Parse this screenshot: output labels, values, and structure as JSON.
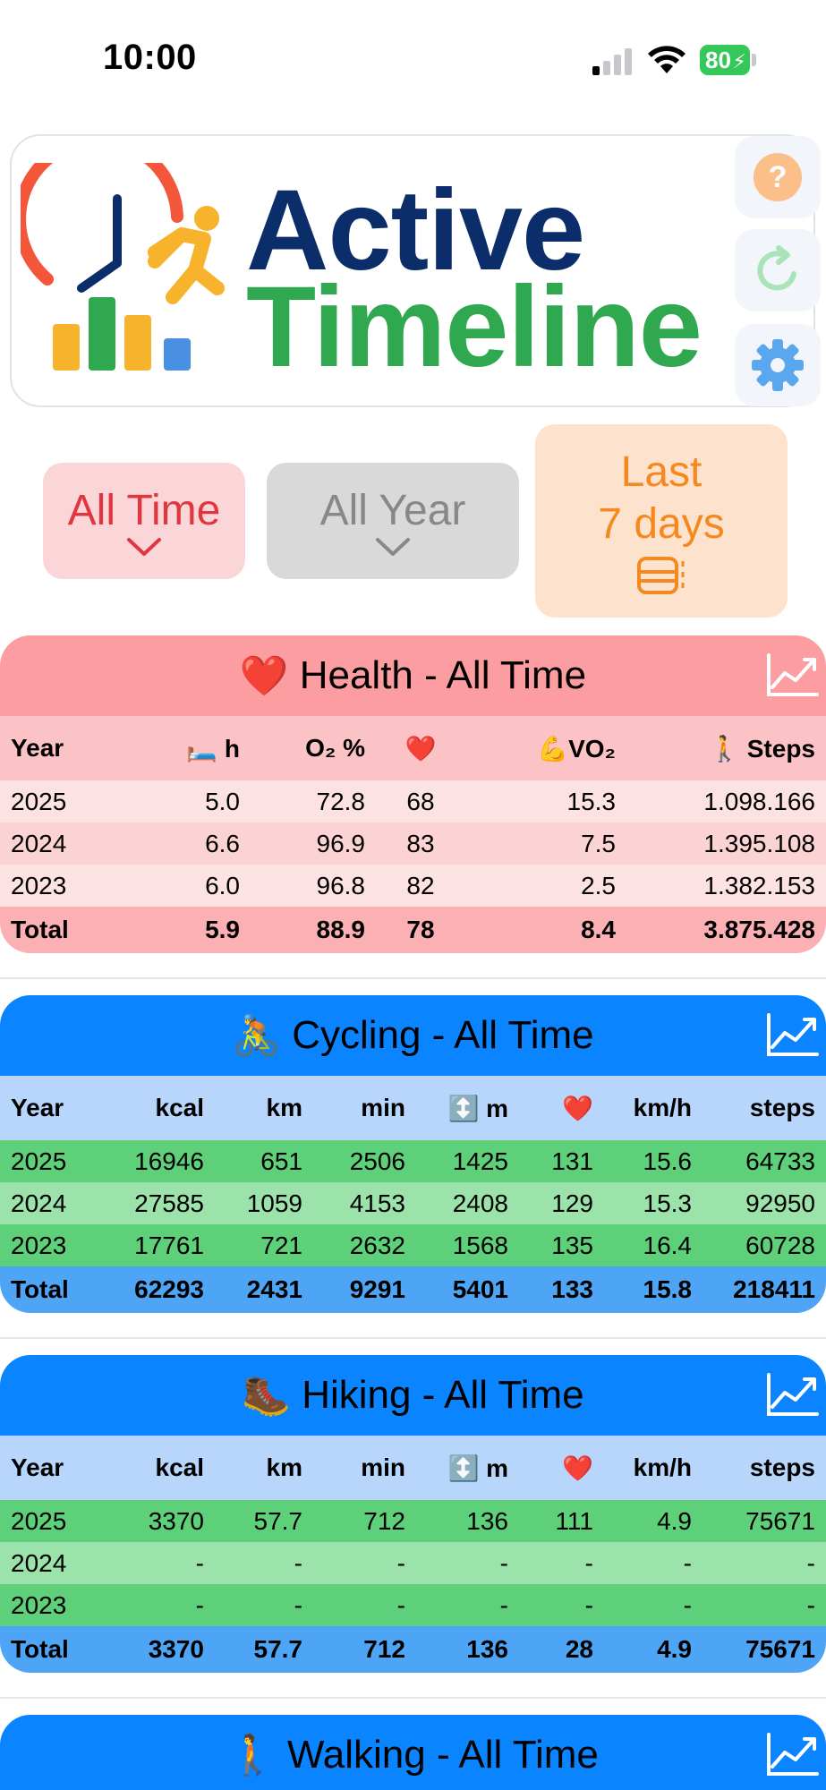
{
  "status_bar": {
    "time": "10:00",
    "battery": "80"
  },
  "header": {
    "title_line1": "Active",
    "title_line2": "Timeline"
  },
  "filters": {
    "all_time": {
      "label": "All Time"
    },
    "all_year": {
      "label": "All Year"
    },
    "last": {
      "line1": "Last",
      "line2": "7 days"
    }
  },
  "health": {
    "emoji": "❤️",
    "title": "Health - All Time",
    "headers": [
      "Year",
      "🛏️ h",
      "O₂ %",
      "❤️",
      "💪VO₂",
      "🚶 Steps"
    ],
    "rows": [
      [
        "2025",
        "5.0",
        "72.8",
        "68",
        "15.3",
        "1.098.166"
      ],
      [
        "2024",
        "6.6",
        "96.9",
        "83",
        "7.5",
        "1.395.108"
      ],
      [
        "2023",
        "6.0",
        "96.8",
        "82",
        "2.5",
        "1.382.153"
      ]
    ],
    "total": [
      "Total",
      "5.9",
      "88.9",
      "78",
      "8.4",
      "3.875.428"
    ]
  },
  "cycling": {
    "emoji": "🚴",
    "title": "Cycling - All Time",
    "headers": [
      "Year",
      "kcal",
      "km",
      "min",
      "↕️ m",
      "❤️",
      "km/h",
      "steps"
    ],
    "rows": [
      [
        "2025",
        "16946",
        "651",
        "2506",
        "1425",
        "131",
        "15.6",
        "64733"
      ],
      [
        "2024",
        "27585",
        "1059",
        "4153",
        "2408",
        "129",
        "15.3",
        "92950"
      ],
      [
        "2023",
        "17761",
        "721",
        "2632",
        "1568",
        "135",
        "16.4",
        "60728"
      ]
    ],
    "total": [
      "Total",
      "62293",
      "2431",
      "9291",
      "5401",
      "133",
      "15.8",
      "218411"
    ]
  },
  "hiking": {
    "emoji": "🥾",
    "title": "Hiking - All Time",
    "headers": [
      "Year",
      "kcal",
      "km",
      "min",
      "↕️ m",
      "❤️",
      "km/h",
      "steps"
    ],
    "rows": [
      [
        "2025",
        "3370",
        "57.7",
        "712",
        "136",
        "111",
        "4.9",
        "75671"
      ],
      [
        "2024",
        "-",
        "-",
        "-",
        "-",
        "-",
        "-",
        "-"
      ],
      [
        "2023",
        "-",
        "-",
        "-",
        "-",
        "-",
        "-",
        "-"
      ]
    ],
    "total": [
      "Total",
      "3370",
      "57.7",
      "712",
      "136",
      "28",
      "4.9",
      "75671"
    ]
  },
  "walking": {
    "emoji": "🚶",
    "title": "Walking - All Time"
  },
  "colors": {
    "health_header": "#fc9da1",
    "blue_header": "#0a84ff",
    "accent_green": "#2fa84f",
    "accent_navy": "#0b2e6b",
    "all_time_red": "#e0363f",
    "last_orange": "#f5891f"
  },
  "icons": {
    "help": "question-circle-icon",
    "refresh": "refresh-icon",
    "settings": "gear-icon",
    "chart": "line-chart-icon",
    "dropdown": "chevron-down-icon",
    "calendar": "calendar-scroll-icon"
  }
}
